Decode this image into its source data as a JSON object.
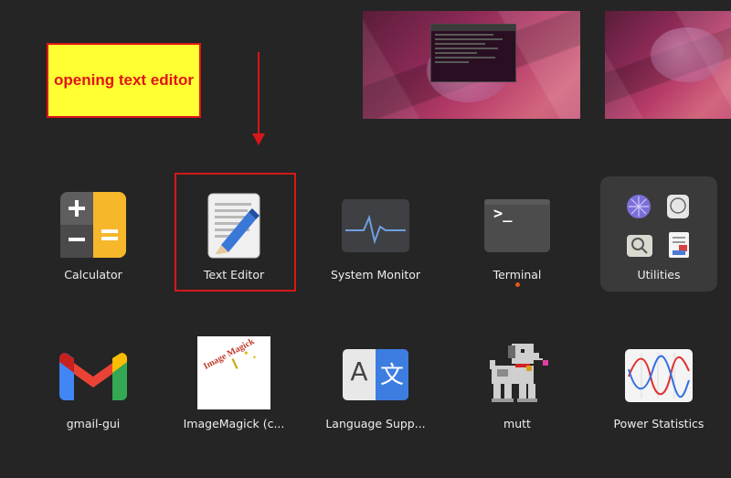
{
  "annotation": {
    "text": "opening text editor"
  },
  "workspaces": {
    "terminal_preview": "terminal"
  },
  "apps_row1": [
    {
      "label": "Calculator"
    },
    {
      "label": "Text Editor"
    },
    {
      "label": "System Monitor"
    },
    {
      "label": "Terminal"
    },
    {
      "label": "Utilities"
    }
  ],
  "apps_row2": [
    {
      "label": "gmail-gui"
    },
    {
      "label": "ImageMagick (c..."
    },
    {
      "label": "Language Supp..."
    },
    {
      "label": "mutt"
    },
    {
      "label": "Power Statistics"
    }
  ],
  "icons": {
    "calculator": "calculator-icon",
    "text_editor": "text-editor-icon",
    "system_monitor": "system-monitor-icon",
    "terminal": "terminal-icon",
    "gmail": "gmail-icon",
    "imagemagick": "imagemagick-icon",
    "language": "language-support-icon",
    "mutt": "mutt-dog-icon",
    "power": "power-statistics-icon"
  },
  "terminal_prompt": ">_",
  "language_glyphs": {
    "left": "A",
    "right": "文"
  },
  "imagemagick_text": "Image Magick",
  "colors": {
    "background": "#252525",
    "annotation_bg": "#ffff33",
    "annotation_border": "#e01515",
    "running_dot": "#e95420"
  }
}
